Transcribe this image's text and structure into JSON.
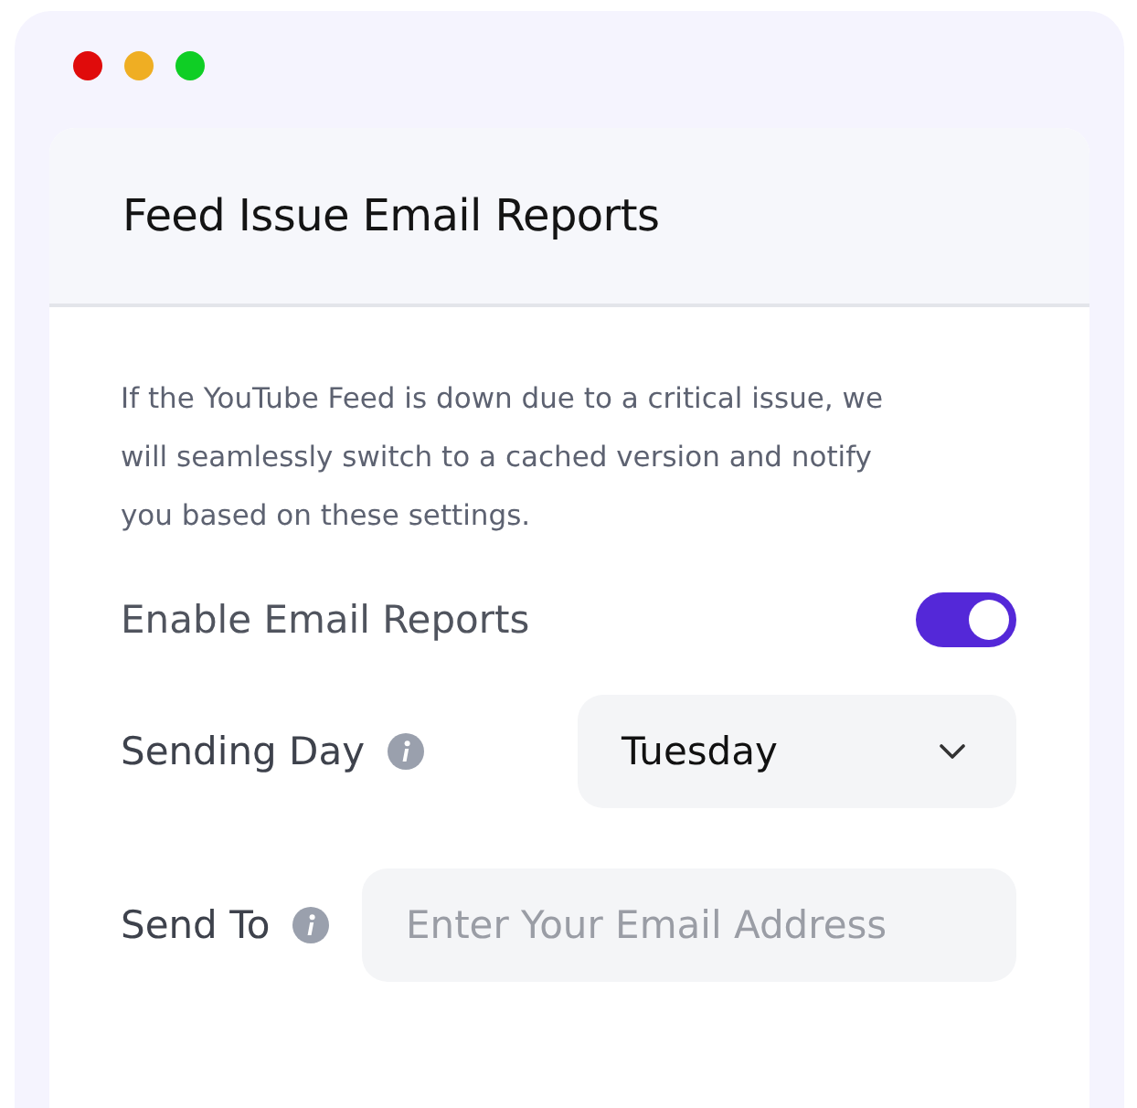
{
  "window": {
    "controls": [
      {
        "color": "#e00b0b"
      },
      {
        "color": "#efae23"
      },
      {
        "color": "#0fce25"
      }
    ]
  },
  "card": {
    "title": "Feed Issue Email Reports",
    "description": "If the YouTube Feed is down due to a critical issue, we will seamlessly switch to a cached version and notify you based on these settings.",
    "settings": [
      {
        "kind": "toggle",
        "label": "Enable Email Reports",
        "info": false,
        "on": true
      },
      {
        "kind": "select",
        "label": "Sending Day",
        "info": true,
        "value": "Tuesday"
      },
      {
        "kind": "input",
        "label": "Send To",
        "info": true,
        "placeholder": "Enter Your Email Address"
      }
    ]
  }
}
